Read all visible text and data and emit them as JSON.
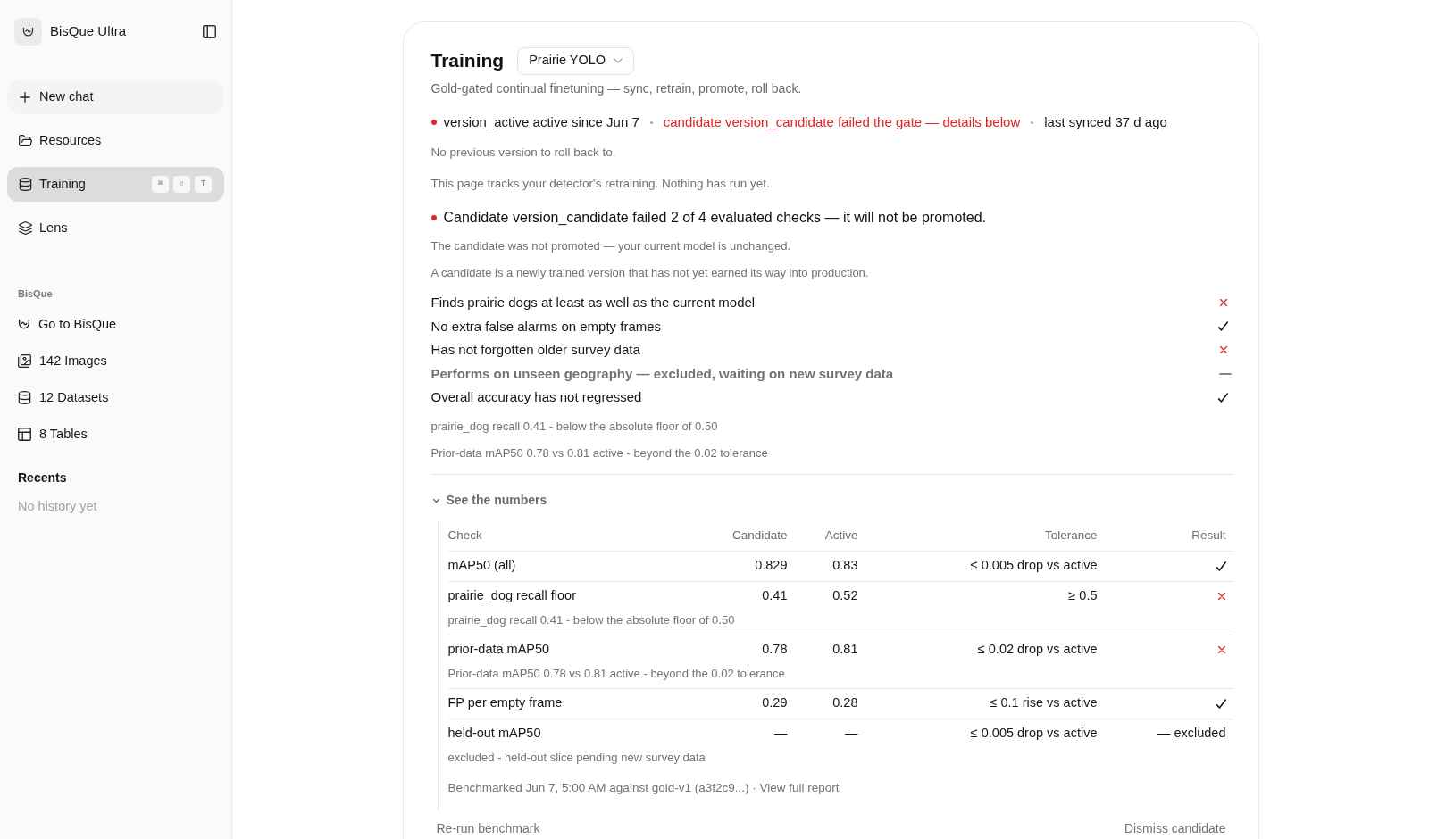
{
  "sidebar": {
    "brand": "BisQue Ultra",
    "new_chat": "New chat",
    "nav": [
      {
        "label": "Resources",
        "selected": false
      },
      {
        "label": "Training",
        "selected": true,
        "shortcut": [
          "⌘",
          "⇧",
          "T"
        ]
      },
      {
        "label": "Lens",
        "selected": false
      }
    ],
    "section_title": "BisQue",
    "links": [
      {
        "label": "Go to BisQue"
      },
      {
        "label": "142 Images"
      },
      {
        "label": "12 Datasets"
      },
      {
        "label": "8 Tables"
      }
    ],
    "recents": {
      "title": "Recents",
      "empty": "No history yet"
    }
  },
  "training": {
    "title": "Training",
    "model_select": "Prairie YOLO",
    "subtitle": "Gold-gated continual finetuning — sync, retrain, promote, roll back.",
    "status": {
      "active": "version_active active since Jun 7",
      "candidate": "candidate version_candidate failed the gate — details below",
      "synced": "last synced 37 d ago"
    },
    "notes": [
      "No previous version to roll back to.",
      "This page tracks your detector's retraining. Nothing has run yet."
    ],
    "verdict": "Candidate version_candidate failed 2 of 4 evaluated checks — it will not be promoted.",
    "verdict_notes": [
      "The candidate was not promoted — your current model is unchanged.",
      "A candidate is a newly trained version that has not yet earned its way into production."
    ],
    "checks": [
      {
        "label": "Finds prairie dogs at least as well as the current model",
        "kind": "fail"
      },
      {
        "label": "No extra false alarms on empty frames",
        "kind": "pass"
      },
      {
        "label": "Has not forgotten older survey data",
        "kind": "fail"
      },
      {
        "label": "Performs on unseen geography — excluded, waiting on new survey data",
        "kind": "excluded"
      },
      {
        "label": "Overall accuracy has not regressed",
        "kind": "pass"
      }
    ],
    "failure_notes": [
      "prairie_dog recall 0.41 - below the absolute floor of 0.50",
      "Prior-data mAP50 0.78 vs 0.81 active - beyond the 0.02 tolerance"
    ],
    "numbers": {
      "toggle": "See the numbers",
      "expanded": true,
      "columns": [
        "Check",
        "Candidate",
        "Active",
        "Tolerance",
        "Result"
      ],
      "rows": [
        {
          "check": "mAP50 (all)",
          "candidate": "0.829",
          "active": "0.83",
          "tolerance": "≤ 0.005 drop vs active",
          "kind": "pass"
        },
        {
          "check": "prairie_dog recall floor",
          "candidate": "0.41",
          "active": "0.52",
          "tolerance": "≥ 0.5",
          "kind": "fail",
          "note": "prairie_dog recall 0.41 - below the absolute floor of 0.50"
        },
        {
          "check": "prior-data mAP50",
          "candidate": "0.78",
          "active": "0.81",
          "tolerance": "≤ 0.02 drop vs active",
          "kind": "fail",
          "note": "Prior-data mAP50 0.78 vs 0.81 active - beyond the 0.02 tolerance"
        },
        {
          "check": "FP per empty frame",
          "candidate": "0.29",
          "active": "0.28",
          "tolerance": "≤ 0.1 rise vs active",
          "kind": "pass"
        },
        {
          "check": "held-out mAP50",
          "candidate": "—",
          "active": "—",
          "tolerance": "≤ 0.005 drop vs active",
          "kind": "excluded",
          "result": "— excluded",
          "note": "excluded - held-out slice pending new survey data"
        }
      ],
      "footer": {
        "text": "Benchmarked Jun 7, 5:00 AM against gold-v1 (a3f2c9...) ·",
        "link": "View full report"
      }
    },
    "actions": [
      "Re-run benchmark",
      "Dismiss candidate"
    ]
  }
}
